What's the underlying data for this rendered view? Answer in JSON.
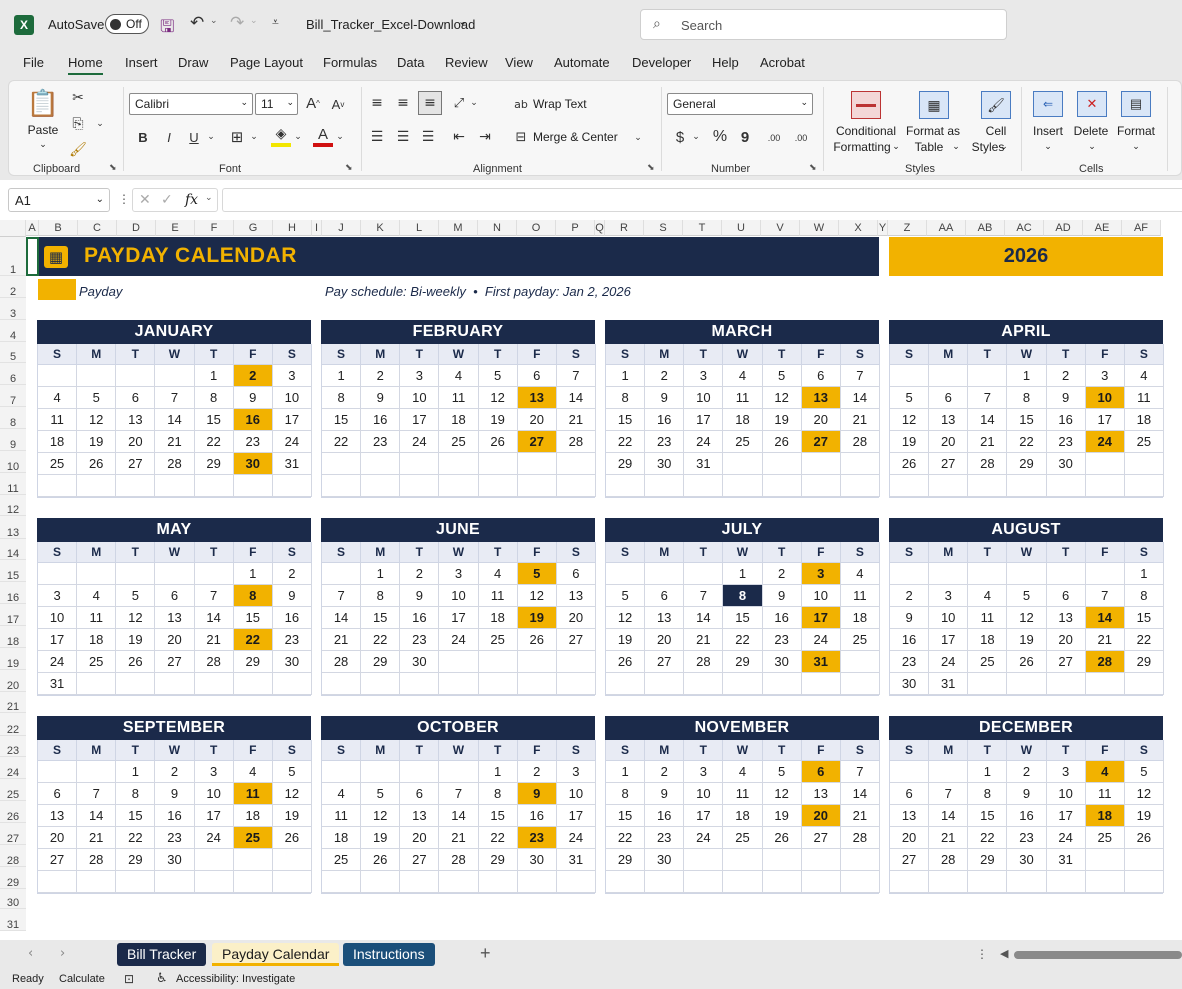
{
  "titlebar": {
    "autosave_label": "AutoSave",
    "autosave_state": "Off",
    "filename": "Bill_Tracker_Excel-Download",
    "search_placeholder": "Search"
  },
  "menu": [
    "File",
    "Home",
    "Insert",
    "Draw",
    "Page Layout",
    "Formulas",
    "Data",
    "Review",
    "View",
    "Automate",
    "Developer",
    "Help",
    "Acrobat"
  ],
  "ribbon": {
    "clipboard": {
      "paste": "Paste",
      "label": "Clipboard"
    },
    "font": {
      "name": "Calibri",
      "size": "11",
      "label": "Font",
      "bold": "B",
      "italic": "I",
      "underline": "U"
    },
    "alignment": {
      "wrap": "Wrap Text",
      "merge": "Merge & Center",
      "label": "Alignment"
    },
    "number": {
      "format": "General",
      "label": "Number",
      "currency": "$",
      "percent": "%",
      "comma": "9",
      "inc_dec": ".00",
      "dec_dec": ".00"
    },
    "styles": {
      "conditional": "Conditional",
      "conditional2": "Formatting",
      "format_table": "Format as",
      "format_table2": "Table",
      "cell_styles": "Cell",
      "cell_styles2": "Styles",
      "label": "Styles"
    },
    "cells": {
      "insert": "Insert",
      "delete": "Delete",
      "format": "Format",
      "label": "Cells"
    }
  },
  "formula": {
    "namebox": "A1",
    "fx": "fx"
  },
  "columns": [
    "A",
    "B",
    "C",
    "D",
    "E",
    "F",
    "G",
    "H",
    "I",
    "J",
    "K",
    "L",
    "M",
    "N",
    "O",
    "P",
    "Q",
    "R",
    "S",
    "T",
    "U",
    "V",
    "W",
    "X",
    "Y",
    "Z",
    "AA",
    "AB",
    "AC",
    "AD",
    "AE",
    "AF"
  ],
  "rows": [
    "1",
    "2",
    "3",
    "4",
    "5",
    "6",
    "7",
    "8",
    "9",
    "10",
    "11",
    "12",
    "13",
    "14",
    "15",
    "16",
    "17",
    "18",
    "19",
    "20",
    "21",
    "22",
    "23",
    "24",
    "25",
    "26",
    "27",
    "28",
    "29",
    "30",
    "31"
  ],
  "sheet": {
    "title": "PAYDAY CALENDAR",
    "year": "2026",
    "legend": "Payday",
    "schedule": "Pay schedule: Bi-weekly  •  First payday: Jan 2, 2026"
  },
  "dow": [
    "S",
    "M",
    "T",
    "W",
    "T",
    "F",
    "S"
  ],
  "months": [
    {
      "name": "JANUARY",
      "offset": 4,
      "days": 31,
      "paydays": [
        2,
        16,
        30
      ]
    },
    {
      "name": "FEBRUARY",
      "offset": 0,
      "days": 28,
      "paydays": [
        13,
        27
      ]
    },
    {
      "name": "MARCH",
      "offset": 0,
      "days": 31,
      "paydays": [
        13,
        27
      ]
    },
    {
      "name": "APRIL",
      "offset": 3,
      "days": 30,
      "paydays": [
        10,
        24
      ]
    },
    {
      "name": "MAY",
      "offset": 5,
      "days": 31,
      "paydays": [
        8,
        22
      ]
    },
    {
      "name": "JUNE",
      "offset": 1,
      "days": 30,
      "paydays": [
        5,
        19
      ]
    },
    {
      "name": "JULY",
      "offset": 3,
      "days": 31,
      "paydays": [
        3,
        17,
        31
      ],
      "today": 8
    },
    {
      "name": "AUGUST",
      "offset": 6,
      "days": 31,
      "paydays": [
        14,
        28
      ]
    },
    {
      "name": "SEPTEMBER",
      "offset": 2,
      "days": 30,
      "paydays": [
        11,
        25
      ]
    },
    {
      "name": "OCTOBER",
      "offset": 4,
      "days": 31,
      "paydays": [
        9,
        23
      ]
    },
    {
      "name": "NOVEMBER",
      "offset": 0,
      "days": 30,
      "paydays": [
        6,
        20
      ]
    },
    {
      "name": "DECEMBER",
      "offset": 2,
      "days": 31,
      "paydays": [
        4,
        18
      ]
    }
  ],
  "tabs": {
    "bill_tracker": "Bill Tracker",
    "payday_calendar": "Payday Calendar",
    "instructions": "Instructions",
    "add": "+"
  },
  "status": {
    "ready": "Ready",
    "calculate": "Calculate",
    "accessibility": "Accessibility: Investigate"
  },
  "colors": {
    "navy": "#1b2a4a",
    "gold": "#f2b200",
    "excel_green": "#1d6b3c"
  }
}
